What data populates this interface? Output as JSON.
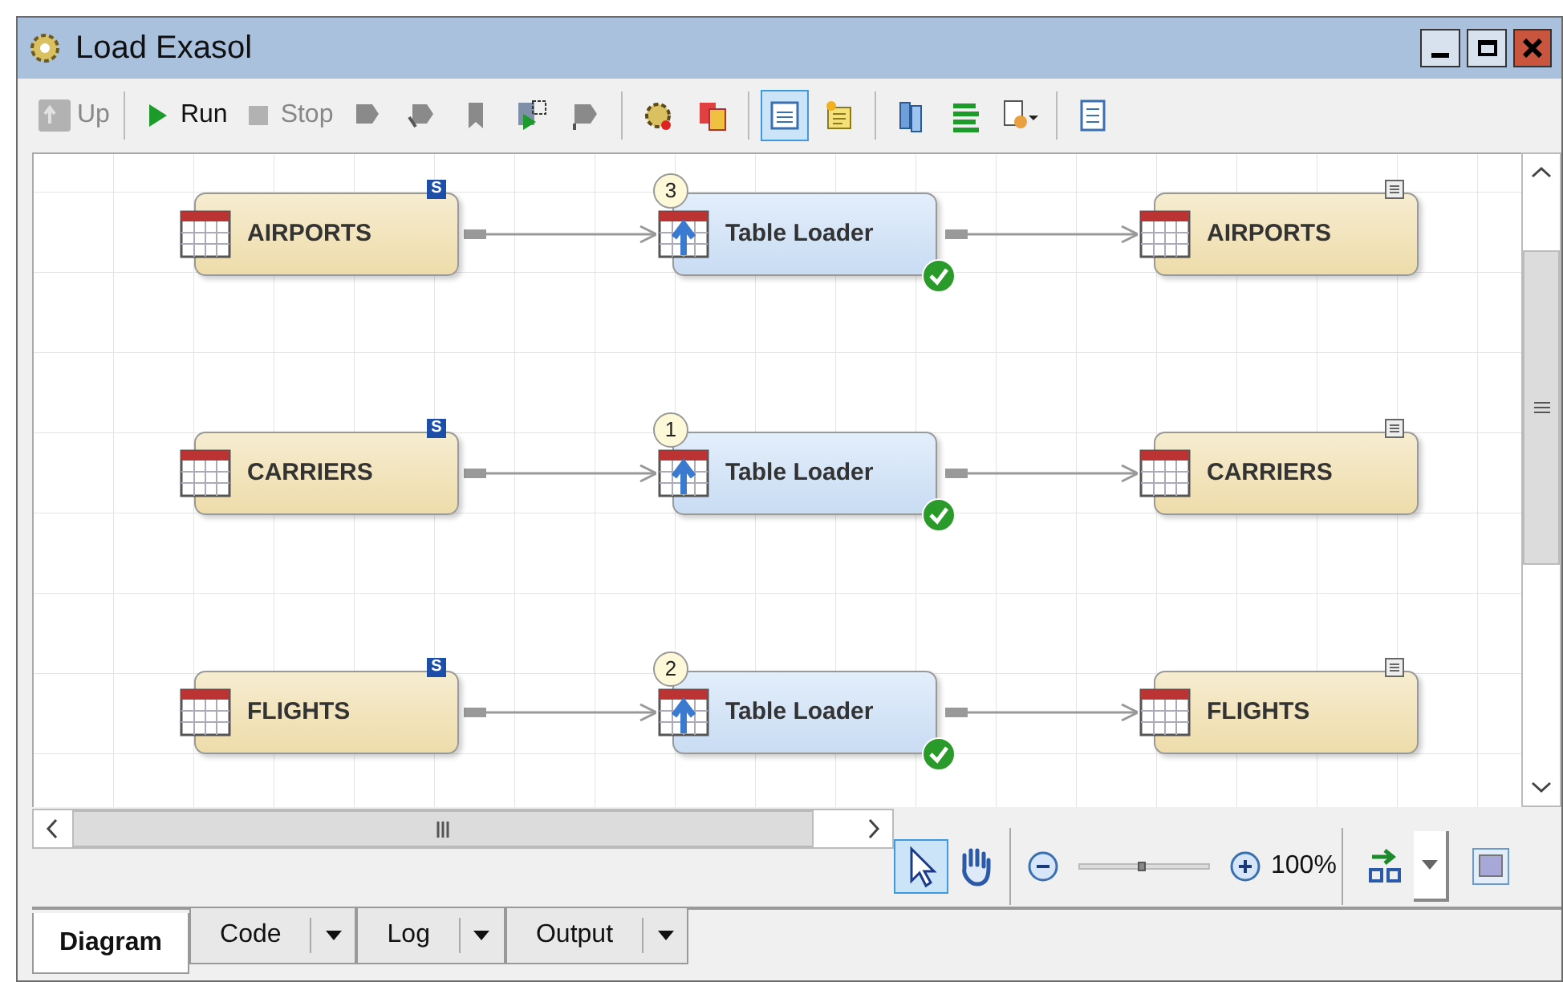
{
  "window": {
    "title": "Load Exasol"
  },
  "toolbar": {
    "text_buttons": [
      {
        "label": "Up",
        "disabled": true
      },
      {
        "label": "Run",
        "disabled": false
      },
      {
        "label": "Stop",
        "disabled": true
      }
    ],
    "icon_buttons": [
      {
        "selected": false
      },
      {
        "selected": false
      },
      {
        "selected": false
      },
      {
        "selected": false
      },
      {
        "selected": false
      },
      {
        "selected": false
      },
      {
        "selected": false
      },
      {
        "selected": true
      },
      {
        "selected": false
      },
      {
        "selected": false
      },
      {
        "selected": false
      },
      {
        "selected": false
      },
      {
        "selected": false
      }
    ]
  },
  "flows": [
    {
      "source": {
        "label": "AIRPORTS",
        "badge": "S"
      },
      "loader": {
        "label": "Table Loader",
        "order": "3",
        "succeeded": true
      },
      "target": {
        "label": "AIRPORTS"
      }
    },
    {
      "source": {
        "label": "CARRIERS",
        "badge": "S"
      },
      "loader": {
        "label": "Table Loader",
        "order": "1",
        "succeeded": true
      },
      "target": {
        "label": "CARRIERS"
      }
    },
    {
      "source": {
        "label": "FLIGHTS",
        "badge": "S"
      },
      "loader": {
        "label": "Table Loader",
        "order": "2",
        "succeeded": true
      },
      "target": {
        "label": "FLIGHTS"
      }
    }
  ],
  "diagram_tools": {
    "tools": [
      {
        "selected": true
      },
      {
        "selected": false
      }
    ],
    "zoom": {
      "level": 0.47,
      "reading": "100%"
    }
  },
  "tabs": [
    {
      "label": "Diagram",
      "selected": true,
      "dropdown": false
    },
    {
      "label": "Code",
      "selected": false,
      "dropdown": true
    },
    {
      "label": "Log",
      "selected": false,
      "dropdown": true
    },
    {
      "label": "Output",
      "selected": false,
      "dropdown": true
    }
  ]
}
